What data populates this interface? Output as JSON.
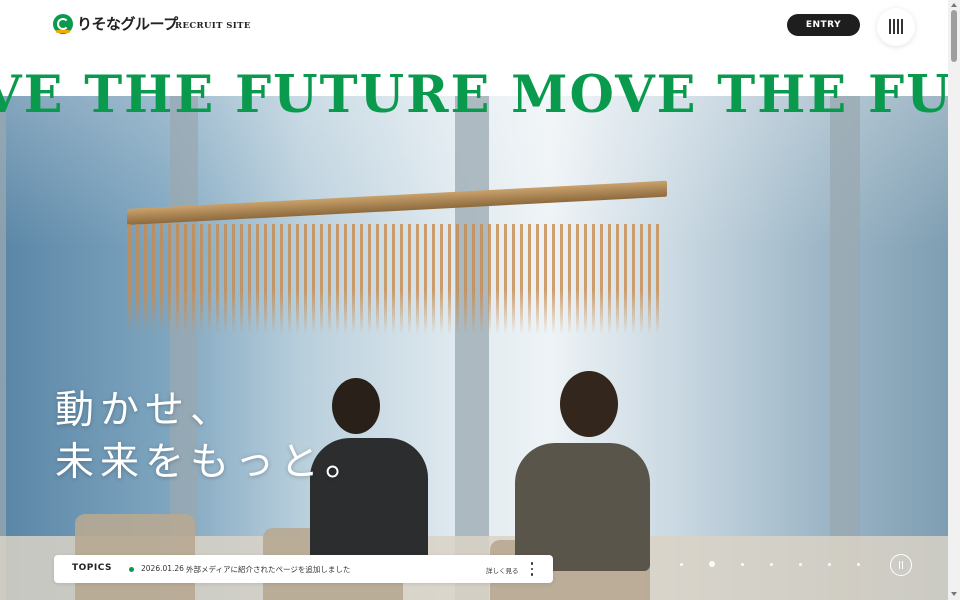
{
  "header": {
    "logo_text": "りそなグループ",
    "site_label": "RECRUIT SITE",
    "entry_label": "ENTRY",
    "menu_icon": "hamburger-vertical-icon"
  },
  "hero": {
    "marquee": "VE THE FUTURE MOVE THE FUTURE MOVE THE FU",
    "catch_line1": "動かせ、",
    "catch_line2": "未来をもっと。",
    "slides_total": 7,
    "slide_active": 2,
    "pause_icon": "pause-icon"
  },
  "topics": {
    "label": "TOPICS",
    "date": "2026.01.26",
    "title": "外部メディアに紹介されたページを追加しました",
    "more_label": "詳しく見る",
    "more_icon": "kebab-icon"
  },
  "colors": {
    "brand_green": "#0a9a4e",
    "entry_bg": "#1e1e1e",
    "logo_accent": "#f2a900"
  }
}
